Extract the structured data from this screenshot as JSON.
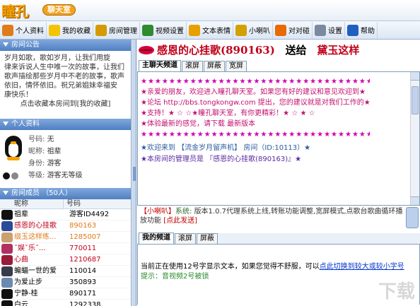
{
  "app": {
    "logo_text": "瞳孔",
    "logo_sub": "聊天室"
  },
  "toolbar": {
    "items": [
      {
        "label": "个人资料",
        "icon": "id-card-icon",
        "color": "#e07b1a"
      },
      {
        "label": "我的收藏",
        "icon": "star-icon",
        "color": "#f4c400"
      },
      {
        "label": "房间管理",
        "icon": "key-icon",
        "color": "#d49a00"
      },
      {
        "label": "视频设置",
        "icon": "video-icon",
        "color": "#2e8b2e"
      },
      {
        "label": "文本表情",
        "icon": "smiley-icon",
        "color": "#e8a000"
      },
      {
        "label": "小喇叭",
        "icon": "horn-icon",
        "color": "#d4a000"
      },
      {
        "label": "对对碰",
        "icon": "gift-icon",
        "color": "#e86a00"
      },
      {
        "label": "设置",
        "icon": "gear-icon",
        "color": "#7a8aa0"
      },
      {
        "label": "帮助",
        "icon": "help-icon",
        "color": "#1f5fbf"
      }
    ]
  },
  "left": {
    "announce_title": "房间公告",
    "announce_lines": [
      "岁月如歌，歌如岁月，让我们用旋",
      "律来诉说人生中唯一次的故事，让我们",
      "歌声描绘那些岁月中不老的故事，歌声",
      "依旧，情怀依旧。祝兄弟姐妹幸福安",
      "康快乐！"
    ],
    "announce_bottom": "点击收藏本房间到[我的收藏]",
    "profile_title": "个人资料",
    "profile": {
      "number_label": "号码:",
      "number_value": "无",
      "nick_label": "昵称:",
      "nick_value": "祖辈",
      "identity_label": "身份:",
      "identity_value": "游客",
      "level_label": "等级:",
      "level_value": "游客无等级"
    },
    "members_title": "房间成员",
    "members_count": "（50人）",
    "col_nick": "昵称",
    "col_id": "号码",
    "members": [
      {
        "nick": "祖辈",
        "id": "游客ID4492",
        "nick_color": "#000000",
        "id_color": "#000000",
        "avatar": "#111111"
      },
      {
        "nick": "感恩的心挂歌",
        "id": "890163",
        "nick_color": "#c0001a",
        "id_color": "#e07b1a",
        "avatar": "#2a4a9a"
      },
      {
        "nick": "缀玉这样练...",
        "id": "1285007",
        "nick_color": "#e07b1a",
        "id_color": "#e07b1a",
        "avatar": "#c9a070"
      },
      {
        "nick": "ˇ娱ˇ乐ˇ...",
        "id": "770011",
        "nick_color": "#c0001a",
        "id_color": "#c0001a",
        "avatar": "#b03060"
      },
      {
        "nick": "心曲",
        "id": "1210687",
        "nick_color": "#c0001a",
        "id_color": "#c0001a",
        "avatar": "#9a1a3a"
      },
      {
        "nick": "蝙蝠一世的爱",
        "id": "110014",
        "nick_color": "#000000",
        "id_color": "#000000",
        "avatar": "#3a3a4a"
      },
      {
        "nick": "为爱止步",
        "id": "350893",
        "nick_color": "#000000",
        "id_color": "#000000",
        "avatar": "#6a8ab0"
      },
      {
        "nick": "宁静-桂",
        "id": "890171",
        "nick_color": "#000000",
        "id_color": "#000000",
        "avatar": "#111111"
      },
      {
        "nick": "白云",
        "id": "1292338",
        "nick_color": "#000000",
        "id_color": "#000000",
        "avatar": "#111111"
      }
    ]
  },
  "main": {
    "headline_song": "感恩的心挂歌(890163)",
    "headline_send": "送给",
    "headline_to": "黛玉这样",
    "tabs": [
      "主聊天频道",
      "滚屏",
      "屏蔽",
      "宽屏"
    ],
    "stars_row": "★★★★★★★★★★★★★★★★★★★★★★★★★★★★★★★★★★★★★★",
    "welcome_lines": [
      "★亲爱的朋友，欢迎进入瞳孔聊天室。如果您有好的建议和意见欢迎到★",
      "★论坛 http://bbs.tongkongw.com 提出，您的建议就是对我们工作的★",
      "★支持！★ ☆ ☆★瞳孔聊天室，有你更精彩！★ ☆ ★ ☆",
      "★体验最新的感觉，请下载 最新版本"
    ],
    "forum_url": "http://bbs.tongkongw.com",
    "download_link": "最新版本",
    "sys1": "★欢迎来到 【流金岁月留声机】 房间（ID:10113）★",
    "sys2": "★本房间的管理员是 『感恩的心挂歌(890163)』★",
    "notice_tag": "【小喇叭】",
    "notice_sys": "系统:",
    "notice_body": "版本1.0.7代理系统上线,转账功能调整,宽屏模式,点歌台歌曲循环播放功能",
    "notice_link": "[点此发送]",
    "tabs2": [
      "我的频道",
      "滚屏",
      "屏蔽"
    ],
    "input_text": "当前正在使用12号字显示文本，如果您觉得不舒服，可以",
    "input_link": "点此切换到较大或较小字号",
    "input_tip": "提示：音视频2号被锁",
    "watermark": "下载"
  }
}
